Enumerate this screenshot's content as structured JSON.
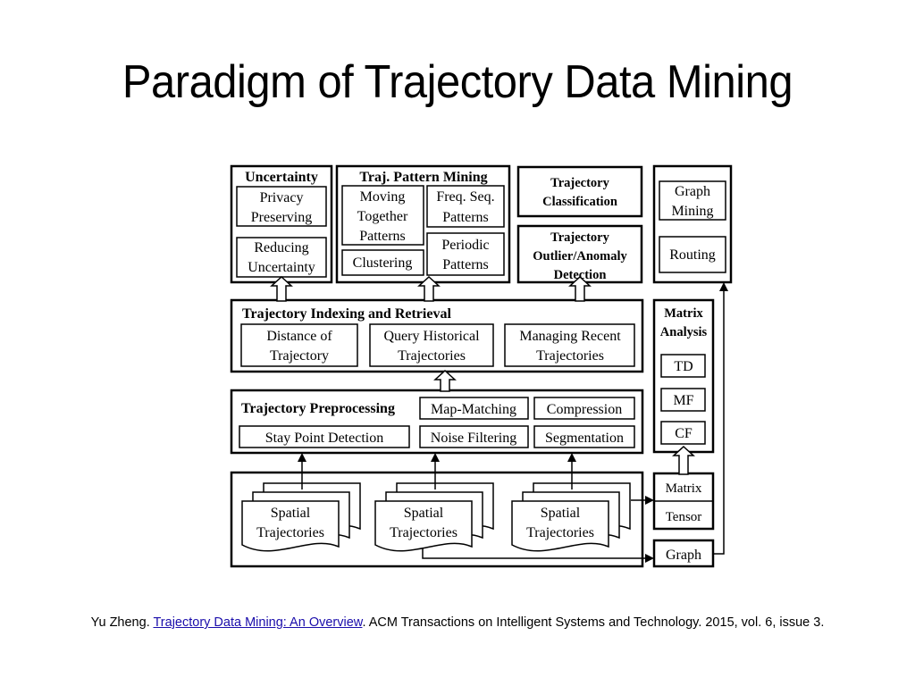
{
  "slide": {
    "title": "Paradigm of Trajectory Data Mining"
  },
  "diagram": {
    "uncertainty": {
      "title": "Uncertainty",
      "items": [
        [
          "Privacy",
          "Preserving"
        ],
        [
          "Reducing",
          "Uncertainty"
        ]
      ]
    },
    "pattern_mining": {
      "title": "Traj. Pattern Mining",
      "moving_together": [
        "Moving",
        "Together",
        "Patterns"
      ],
      "clustering": "Clustering",
      "freq_seq": [
        "Freq. Seq.",
        "Patterns"
      ],
      "periodic": [
        "Periodic",
        "Patterns"
      ]
    },
    "classification": [
      "Trajectory",
      "Classification"
    ],
    "outlier": [
      "Trajectory",
      "Outlier/Anomaly",
      "Detection"
    ],
    "graph_box": {
      "graph_mining": [
        "Graph",
        "Mining"
      ],
      "routing": "Routing"
    },
    "indexing": {
      "title": "Trajectory Indexing and Retrieval",
      "items": [
        [
          "Distance of",
          "Trajectory"
        ],
        [
          "Query Historical",
          "Trajectories"
        ],
        [
          "Managing Recent",
          "Trajectories"
        ]
      ]
    },
    "matrix_analysis": {
      "title": [
        "Matrix",
        "Analysis"
      ],
      "items": [
        "TD",
        "MF",
        "CF"
      ]
    },
    "preprocessing": {
      "title": "Trajectory Preprocessing",
      "items": [
        "Map-Matching",
        "Compression",
        "Stay Point Detection",
        "Noise Filtering",
        "Segmentation"
      ]
    },
    "data_sources": {
      "documents": [
        [
          "Spatial",
          "Trajectories"
        ],
        [
          "Spatial",
          "Trajectories"
        ],
        [
          "Spatial",
          "Trajectories"
        ]
      ]
    },
    "structures": {
      "matrix": "Matrix",
      "tensor": "Tensor",
      "graph": "Graph"
    }
  },
  "citation": {
    "author": "Yu Zheng. ",
    "link_text": "Trajectory Data Mining: An Overview",
    "rest": ". ACM Transactions on Intelligent Systems and Technology. 2015, vol. 6, issue 3.",
    "link_color": "#1a0dab"
  }
}
